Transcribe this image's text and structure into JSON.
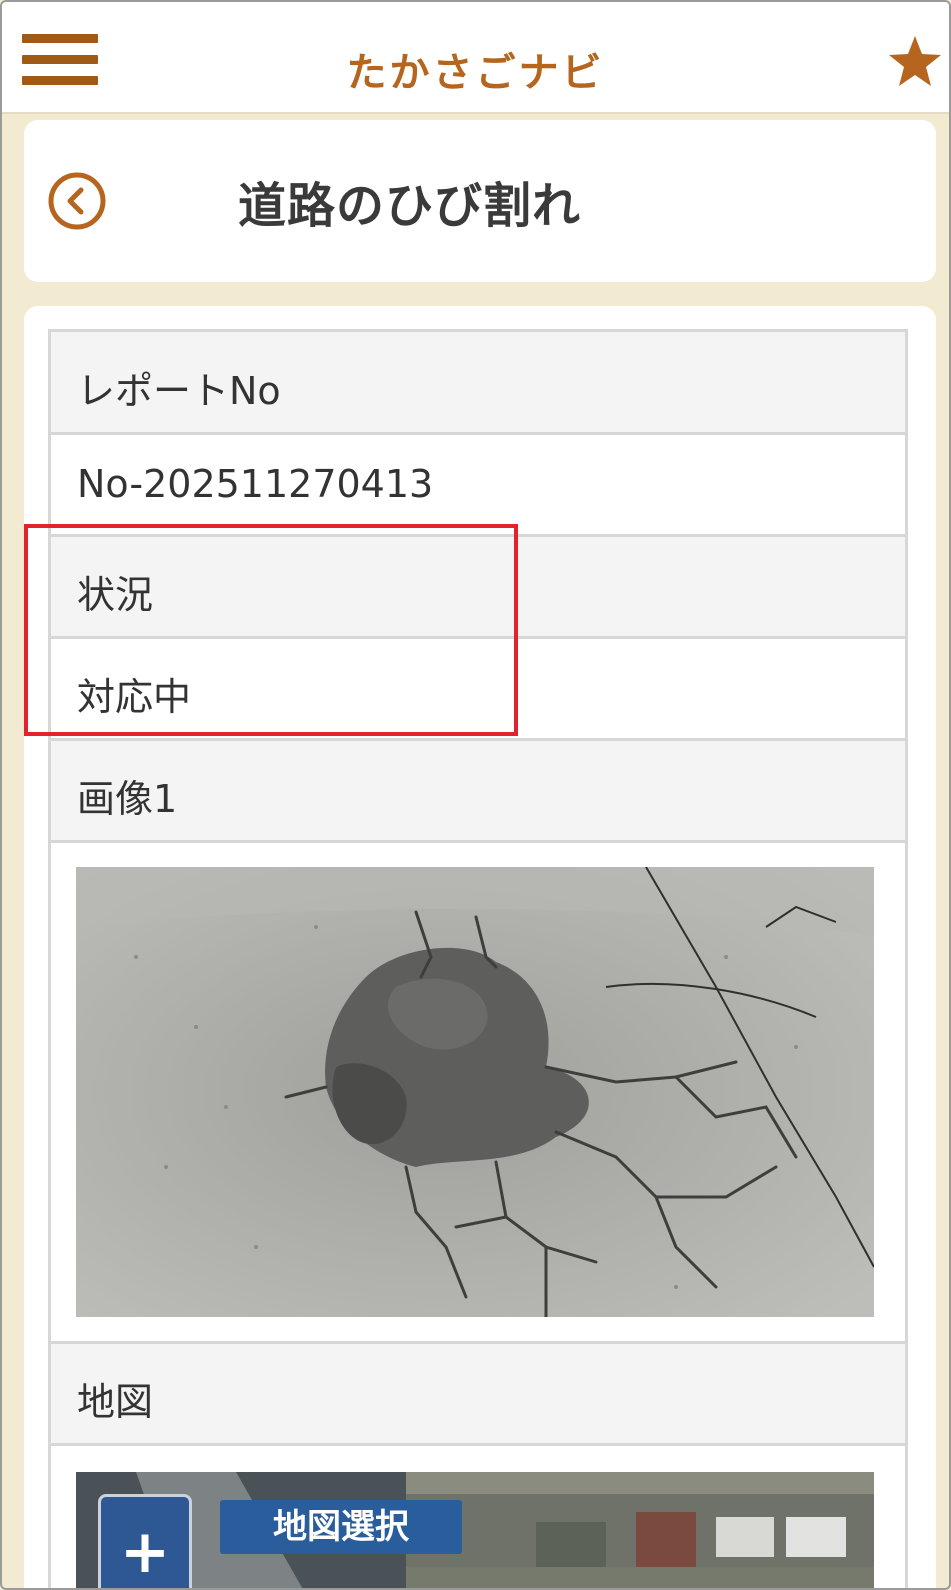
{
  "header": {
    "app_title": "たかさごナビ"
  },
  "page": {
    "title": "道路のひび割れ"
  },
  "details": {
    "report_no_label": "レポートNo",
    "report_no_value": "No-202511270413",
    "status_label": "状況",
    "status_value": "対応中",
    "image_label": "画像1",
    "map_label": "地図"
  },
  "map": {
    "zoom_in_label": "+",
    "select_label": "地図選択"
  },
  "colors": {
    "accent": "#b5651d",
    "highlight": "#e3232b",
    "map_button": "#2a5d9c"
  }
}
